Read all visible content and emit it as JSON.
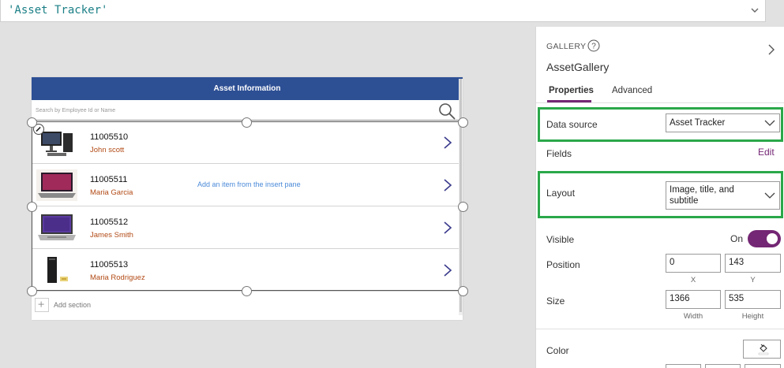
{
  "formula": {
    "value": "'Asset Tracker'",
    "expand_icon": "chevron-down-icon"
  },
  "app": {
    "header_title": "Asset Information",
    "search_placeholder": "Search by Employee Id or Name",
    "search_icon": "search-icon",
    "empty_message": "Add an item from the insert pane",
    "add_section_label": "Add section",
    "items": [
      {
        "title": "11005510",
        "subtitle": "John scott",
        "image": "desktop-computer"
      },
      {
        "title": "11005511",
        "subtitle": "Maria Garcia",
        "image": "laptop-red"
      },
      {
        "title": "11005512",
        "subtitle": "James Smith",
        "image": "laptop-silver"
      },
      {
        "title": "11005513",
        "subtitle": "Maria Rodriguez",
        "image": "tower-pc"
      }
    ]
  },
  "panel": {
    "type_label": "GALLERY",
    "control_name": "AssetGallery",
    "tabs": [
      {
        "label": "Properties",
        "active": true
      },
      {
        "label": "Advanced",
        "active": false
      }
    ],
    "data_source": {
      "label": "Data source",
      "value": "Asset Tracker"
    },
    "fields": {
      "label": "Fields",
      "action": "Edit"
    },
    "layout": {
      "label": "Layout",
      "value_line1": "Image, title, and",
      "value_line2": "subtitle"
    },
    "visible": {
      "label": "Visible",
      "state": "On",
      "checked": true
    },
    "position": {
      "label": "Position",
      "x": "0",
      "y": "143",
      "x_caption": "X",
      "y_caption": "Y"
    },
    "size": {
      "label": "Size",
      "width": "1366",
      "height": "535",
      "width_caption": "Width",
      "height_caption": "Height"
    },
    "color": {
      "label": "Color"
    }
  },
  "colors": {
    "header": "#2d4f94",
    "accent": "#742774",
    "highlight": "#2aa84a",
    "subtitle": "#b24a15"
  }
}
